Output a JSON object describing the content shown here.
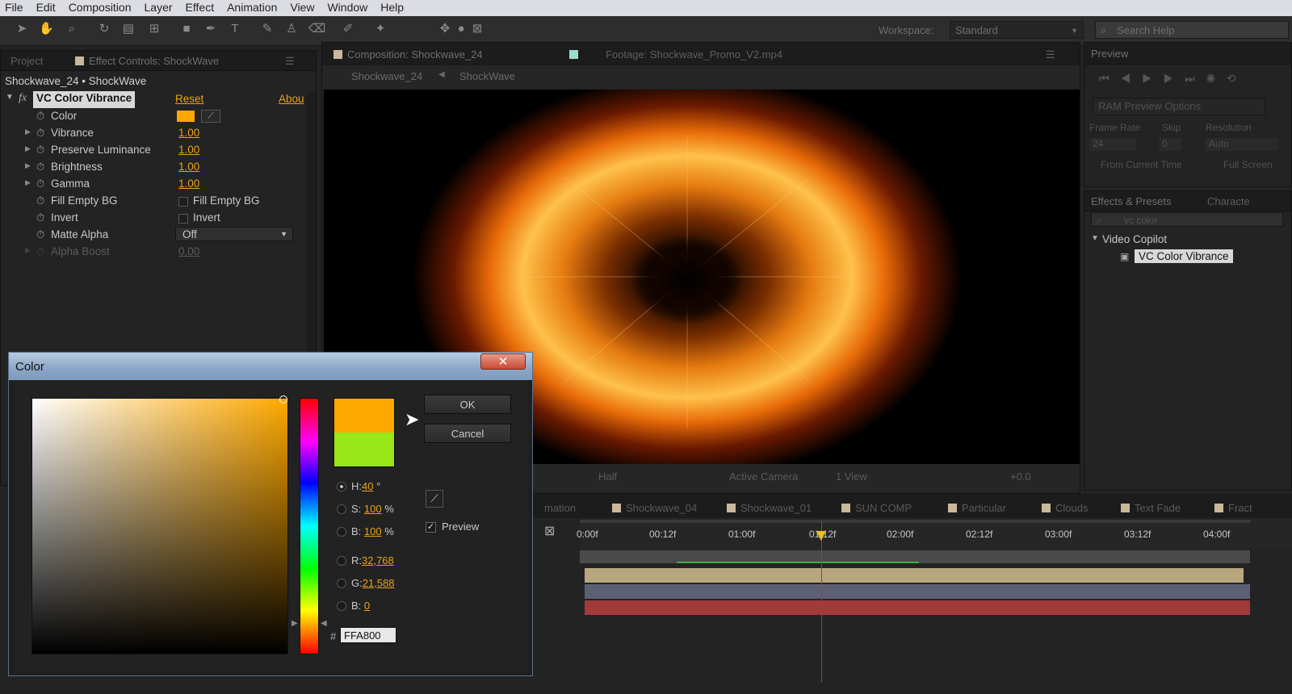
{
  "menu": [
    "File",
    "Edit",
    "Composition",
    "Layer",
    "Effect",
    "Animation",
    "View",
    "Window",
    "Help"
  ],
  "toolbar": {
    "workspace_label": "Workspace:",
    "workspace_value": "Standard",
    "search_placeholder": "Search Help"
  },
  "left_panel": {
    "tabs": [
      "Project",
      "Effect Controls: ShockWave"
    ],
    "breadcrumb": "Shockwave_24 • ShockWave",
    "effect_name": "VC Color Vibrance",
    "reset": "Reset",
    "about": "Abou",
    "color_label": "Color",
    "color_swatch": "#ffa800",
    "params": [
      {
        "name": "Vibrance",
        "value": "1.00"
      },
      {
        "name": "Preserve Luminance",
        "value": "1.00"
      },
      {
        "name": "Brightness",
        "value": "1.00"
      },
      {
        "name": "Gamma",
        "value": "1.00"
      }
    ],
    "fill_empty_bg": {
      "name": "Fill Empty BG",
      "checkbox": "Fill Empty BG"
    },
    "invert": {
      "name": "Invert",
      "checkbox": "Invert"
    },
    "matte_alpha": {
      "name": "Matte Alpha",
      "value": "Off"
    },
    "alpha_boost": {
      "name": "Alpha Boost",
      "value": "0.00"
    }
  },
  "comp_panel": {
    "tabs": [
      "Composition: Shockwave_24",
      "Footage: Shockwave_Promo_V2.mp4"
    ],
    "breadcrumbs": [
      "Shockwave_24",
      "ShockWave"
    ],
    "footer": {
      "resolution": "Half",
      "camera": "Active Camera",
      "view": "1 View",
      "exposure": "+0.0"
    }
  },
  "preview_panel": {
    "tab": "Preview",
    "ram_options": "RAM Preview Options",
    "frame_rate_label": "Frame Rate",
    "skip_label": "Skip",
    "resolution_label": "Resolution",
    "frame_rate": "24",
    "skip": "0",
    "resolution": "Auto",
    "from_current": "From Current Time",
    "full_screen": "Full Screen"
  },
  "effects_panel": {
    "tabs": [
      "Effects & Presets",
      "Characte"
    ],
    "search": "vc color",
    "folder": "Video Copilot",
    "item": "VC Color Vibrance"
  },
  "timeline": {
    "tabs": [
      "mation",
      "Shockwave_04",
      "Shockwave_01",
      "SUN COMP",
      "Particular",
      "Clouds",
      "Text Fade",
      "Fract"
    ],
    "ticks": [
      "0:00f",
      "00:12f",
      "01:00f",
      "01:12f",
      "02:00f",
      "02:12f",
      "03:00f",
      "03:12f",
      "04:00f"
    ],
    "playhead_fraction": 0.36
  },
  "color_dialog": {
    "title": "Color",
    "ok": "OK",
    "cancel": "Cancel",
    "h_label": "H:",
    "h_value": "40",
    "h_unit": "°",
    "s_label": "S:",
    "s_value": "100",
    "s_unit": "%",
    "b_label": "B:",
    "b_value": "100",
    "b_unit": "%",
    "r_label": "R:",
    "r_value": "32,768",
    "g_label": "G:",
    "g_value": "21,588",
    "bb_label": "B:",
    "bb_value": "0",
    "hash": "#",
    "hex": "FFA800",
    "preview_label": "Preview",
    "new_color": "#ffa800",
    "old_color": "#99e619"
  }
}
